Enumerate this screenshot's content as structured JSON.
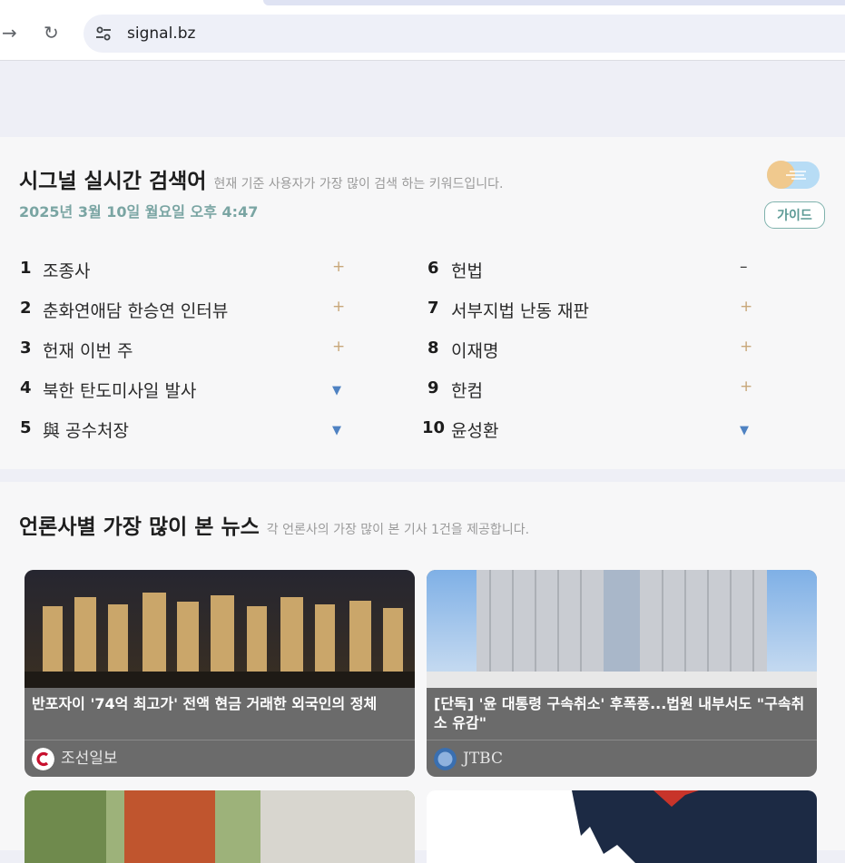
{
  "browser": {
    "url": "signal.bz",
    "forward_icon": "forward-arrow-icon",
    "reload_icon": "reload-icon",
    "site_settings_icon": "tune-icon"
  },
  "realtime": {
    "title": "시그널 실시간 검색어",
    "subtitle": "현재 기준 사용자가 가장 많이 검색 하는 키워드입니다.",
    "datetime": "2025년 3월 10일 월요일 오후 4:47",
    "guide_label": "가이드",
    "toggle_state": "off",
    "ranks": [
      {
        "rank": "1",
        "keyword": "조종사",
        "trend": "+",
        "trend_type": "new"
      },
      {
        "rank": "2",
        "keyword": "춘화연애담 한승연 인터뷰",
        "trend": "+",
        "trend_type": "new"
      },
      {
        "rank": "3",
        "keyword": "헌재 이번 주",
        "trend": "+",
        "trend_type": "new"
      },
      {
        "rank": "4",
        "keyword": "북한 탄도미사일 발사",
        "trend": "▼",
        "trend_type": "down"
      },
      {
        "rank": "5",
        "keyword": "與 공수처장",
        "trend": "▼",
        "trend_type": "down"
      },
      {
        "rank": "6",
        "keyword": "헌법",
        "trend": "–",
        "trend_type": "same"
      },
      {
        "rank": "7",
        "keyword": "서부지법 난동 재판",
        "trend": "+",
        "trend_type": "new"
      },
      {
        "rank": "8",
        "keyword": "이재명",
        "trend": "+",
        "trend_type": "new"
      },
      {
        "rank": "9",
        "keyword": "한컴",
        "trend": "+",
        "trend_type": "new"
      },
      {
        "rank": "10",
        "keyword": "윤성환",
        "trend": "▼",
        "trend_type": "down"
      }
    ]
  },
  "news": {
    "title": "언론사별 가장 많이 본 뉴스",
    "subtitle": "각 언론사의 가장 많이 본 기사 1건을 제공합니다.",
    "items": [
      {
        "headline": "반포자이 '74억 최고가' 전액 현금 거래한 외국인의 정체",
        "source": "조선일보",
        "logo_color": "#c8102e"
      },
      {
        "headline": "[단독] '윤 대통령 구속취소' 후폭풍...법원 내부서도 \"구속취소 유감\"",
        "source": "JTBC",
        "logo_color": "#3a6fb0"
      }
    ]
  },
  "colors": {
    "accent": "#7aa5a3",
    "new_marker": "#c8a77a",
    "down_marker": "#4f82c2"
  }
}
